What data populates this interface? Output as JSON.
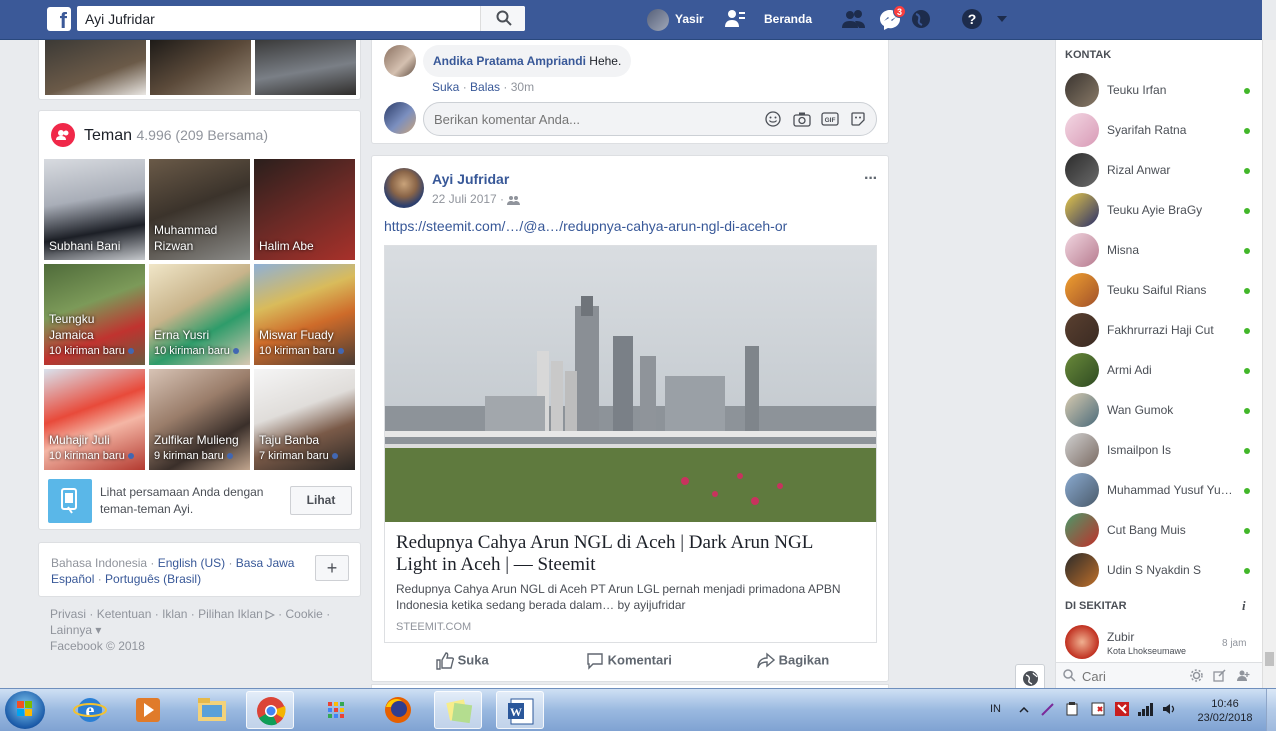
{
  "topbar": {
    "search_value": "Ayi Jufridar",
    "profile_name": "Yasir",
    "home_label": "Beranda",
    "messages_badge": "3"
  },
  "friends": {
    "title": "Teman",
    "count": "4.996 (209 Bersama)",
    "items": [
      {
        "name": "Subhani Bani",
        "sub": ""
      },
      {
        "name": "Muhammad Rizwan",
        "sub": ""
      },
      {
        "name": "Halim Abe",
        "sub": ""
      },
      {
        "name": "Teungku Jamaica",
        "sub": "10 kiriman baru"
      },
      {
        "name": "Erna Yusri",
        "sub": "10 kiriman baru"
      },
      {
        "name": "Miswar Fuady",
        "sub": "10 kiriman baru"
      },
      {
        "name": "Muhajir Juli",
        "sub": "10 kiriman baru"
      },
      {
        "name": "Zulfikar Mulieng",
        "sub": "9 kiriman baru"
      },
      {
        "name": "Taju Banba",
        "sub": "7 kiriman baru"
      }
    ],
    "compare_text": "Lihat persamaan Anda dengan teman-teman Ayi.",
    "compare_button": "Lihat"
  },
  "languages": {
    "current": "Bahasa Indonesia",
    "links": [
      "English (US)",
      "Basa Jawa",
      "Español",
      "Português (Brasil)"
    ],
    "add_label": "+"
  },
  "footer": {
    "links": [
      "Privasi",
      "Ketentuan",
      "Iklan",
      "Pilihan Iklan",
      "Cookie",
      "Lainnya"
    ],
    "copyright": "Facebook © 2018"
  },
  "comment": {
    "author": "Andika Pratama Ampriandi",
    "text": "Hehe.",
    "like": "Suka",
    "reply": "Balas",
    "time": "30m",
    "input_placeholder": "Berikan komentar Anda..."
  },
  "post": {
    "author": "Ayi Jufridar",
    "date": "22 Juli 2017",
    "url_text": "https://steemit.com/…/@a…/redupnya-cahya-arun-ngl-di-aceh-or",
    "link_title": "Redupnya Cahya Arun NGL di Aceh | Dark Arun NGL Light in Aceh | — Steemit",
    "link_desc": "Redupnya Cahya Arun NGL di Aceh PT Arun LGL pernah menjadi primadona APBN Indonesia ketika sedang berada dalam… by ayijufridar",
    "link_domain": "STEEMIT.COM",
    "actions": {
      "like": "Suka",
      "comment": "Komentari",
      "share": "Bagikan"
    },
    "menu": "···"
  },
  "chat": {
    "header": "KONTAK",
    "contacts": [
      "Teuku Irfan",
      "Syarifah Ratna",
      "Rizal Anwar",
      "Teuku Ayie BraGy",
      "Misna",
      "Teuku Saiful Rians",
      "Fakhrurrazi Haji Cut",
      "Armi Adi",
      "Wan Gumok",
      "Ismailpon Is",
      "Muhammad Yusuf Yu…",
      "Cut Bang Muis",
      "Udin S Nyakdin S"
    ],
    "nearby_header": "DI SEKITAR",
    "nearby": {
      "name": "Zubir",
      "location": "Kota Lhokseumawe",
      "time": "8 jam"
    },
    "search_placeholder": "Cari"
  },
  "taskbar": {
    "lang": "IN",
    "time": "10:46",
    "date": "23/02/2018"
  },
  "colors": {
    "brand": "#3b5998",
    "link": "#385898",
    "online": "#42b72a",
    "badge": "#fa3e3e"
  }
}
